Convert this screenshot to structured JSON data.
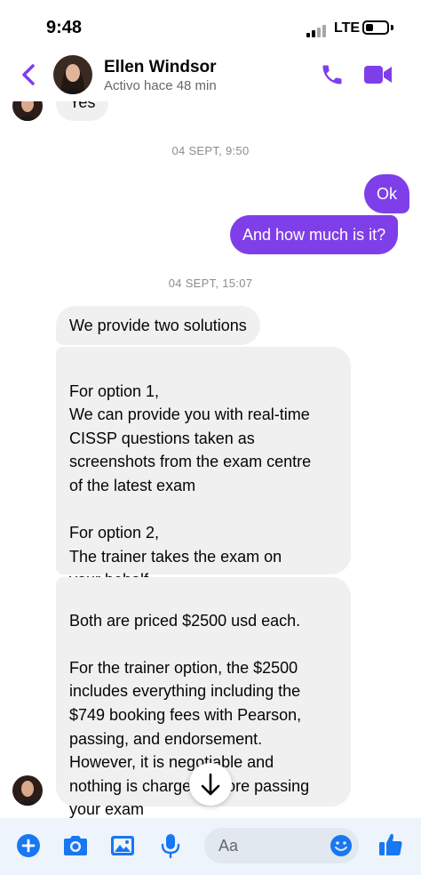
{
  "status_bar": {
    "time": "9:48",
    "network": "LTE"
  },
  "header": {
    "contact_name": "Ellen Windsor",
    "contact_status": "Activo hace 48 min",
    "icons": {
      "back": "chevron-left-icon",
      "call": "phone-icon",
      "video": "video-camera-icon"
    },
    "accent_color": "#7f3fe8"
  },
  "chat": {
    "partial_incoming": "Yes",
    "timestamp_1": "04 SEPT, 9:50",
    "outgoing": [
      "Ok",
      "And how much is it?"
    ],
    "timestamp_2": "04 SEPT, 15:07",
    "incoming": [
      "We provide two solutions",
      "For option 1,\nWe can provide you with real-time\nCISSP questions taken as\nscreenshots from the exam centre\nof the latest exam\n\nFor option 2,\nThe trainer takes the exam on\nyour behalf.",
      "Both are priced $2500 usd each.\n\nFor the trainer option, the $2500\nincludes everything including the\n$749 booking fees with Pearson,\npassing, and endorsement.\nHowever, it is negotiable and\nnothing is charged before passing\nyour exam"
    ],
    "bubble_colors": {
      "incoming_bg": "#f0f0f0",
      "outgoing_bg": "#7f3fe8"
    }
  },
  "composer": {
    "placeholder": "Aa",
    "icons": [
      "plus-icon",
      "camera-icon",
      "image-icon",
      "microphone-icon",
      "emoji-icon",
      "thumbs-up-icon"
    ]
  },
  "scroll_button": {
    "icon": "arrow-down-icon"
  }
}
